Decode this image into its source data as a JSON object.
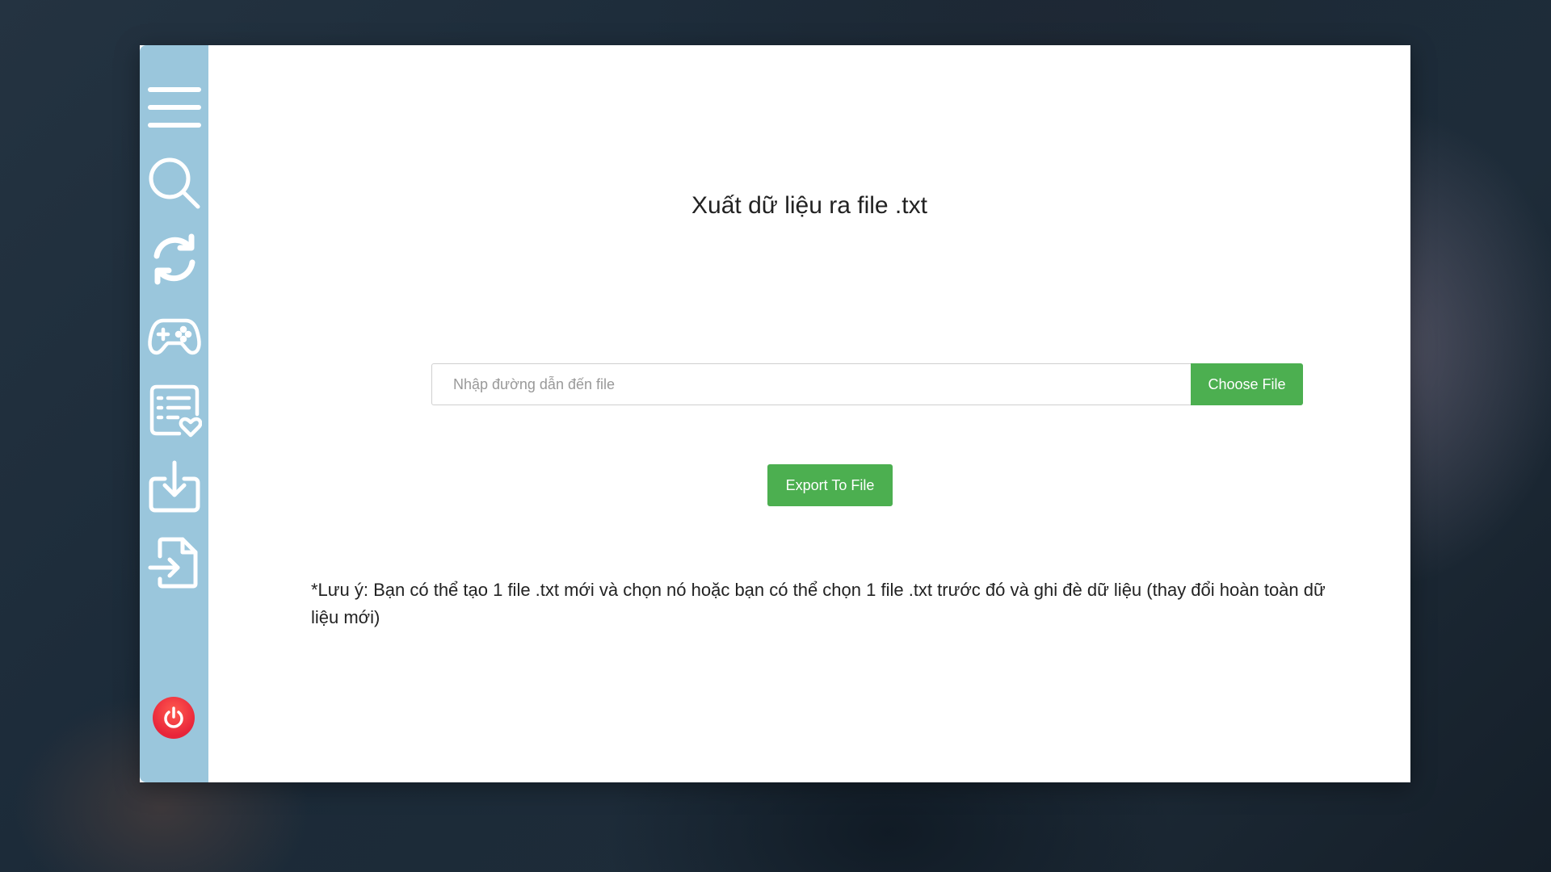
{
  "window": {
    "title": "Xuất dữ liệu ra file .txt"
  },
  "sidebar": {
    "items": [
      {
        "id": "menu",
        "icon": "hamburger-menu-icon"
      },
      {
        "id": "search",
        "icon": "search-icon"
      },
      {
        "id": "sync",
        "icon": "refresh-icon"
      },
      {
        "id": "games",
        "icon": "gamepad-icon"
      },
      {
        "id": "wishlist",
        "icon": "list-heart-icon"
      },
      {
        "id": "import",
        "icon": "download-icon"
      },
      {
        "id": "export",
        "icon": "file-export-icon"
      }
    ],
    "power_icon": "power-icon"
  },
  "form": {
    "path_value": "",
    "path_placeholder": "Nhập đường dẫn đến file",
    "choose_label": "Choose File",
    "export_label": "Export To File"
  },
  "note": "*Lưu ý: Bạn có thể tạo 1 file .txt mới và chọn nó hoặc bạn có thể chọn 1 file .txt trước đó và ghi đè dữ liệu (thay đổi hoàn toàn dữ liệu mới)",
  "colors": {
    "sidebar": "#9ac6dc",
    "accent_green": "#4caf50",
    "power_red": "#e8243a"
  }
}
